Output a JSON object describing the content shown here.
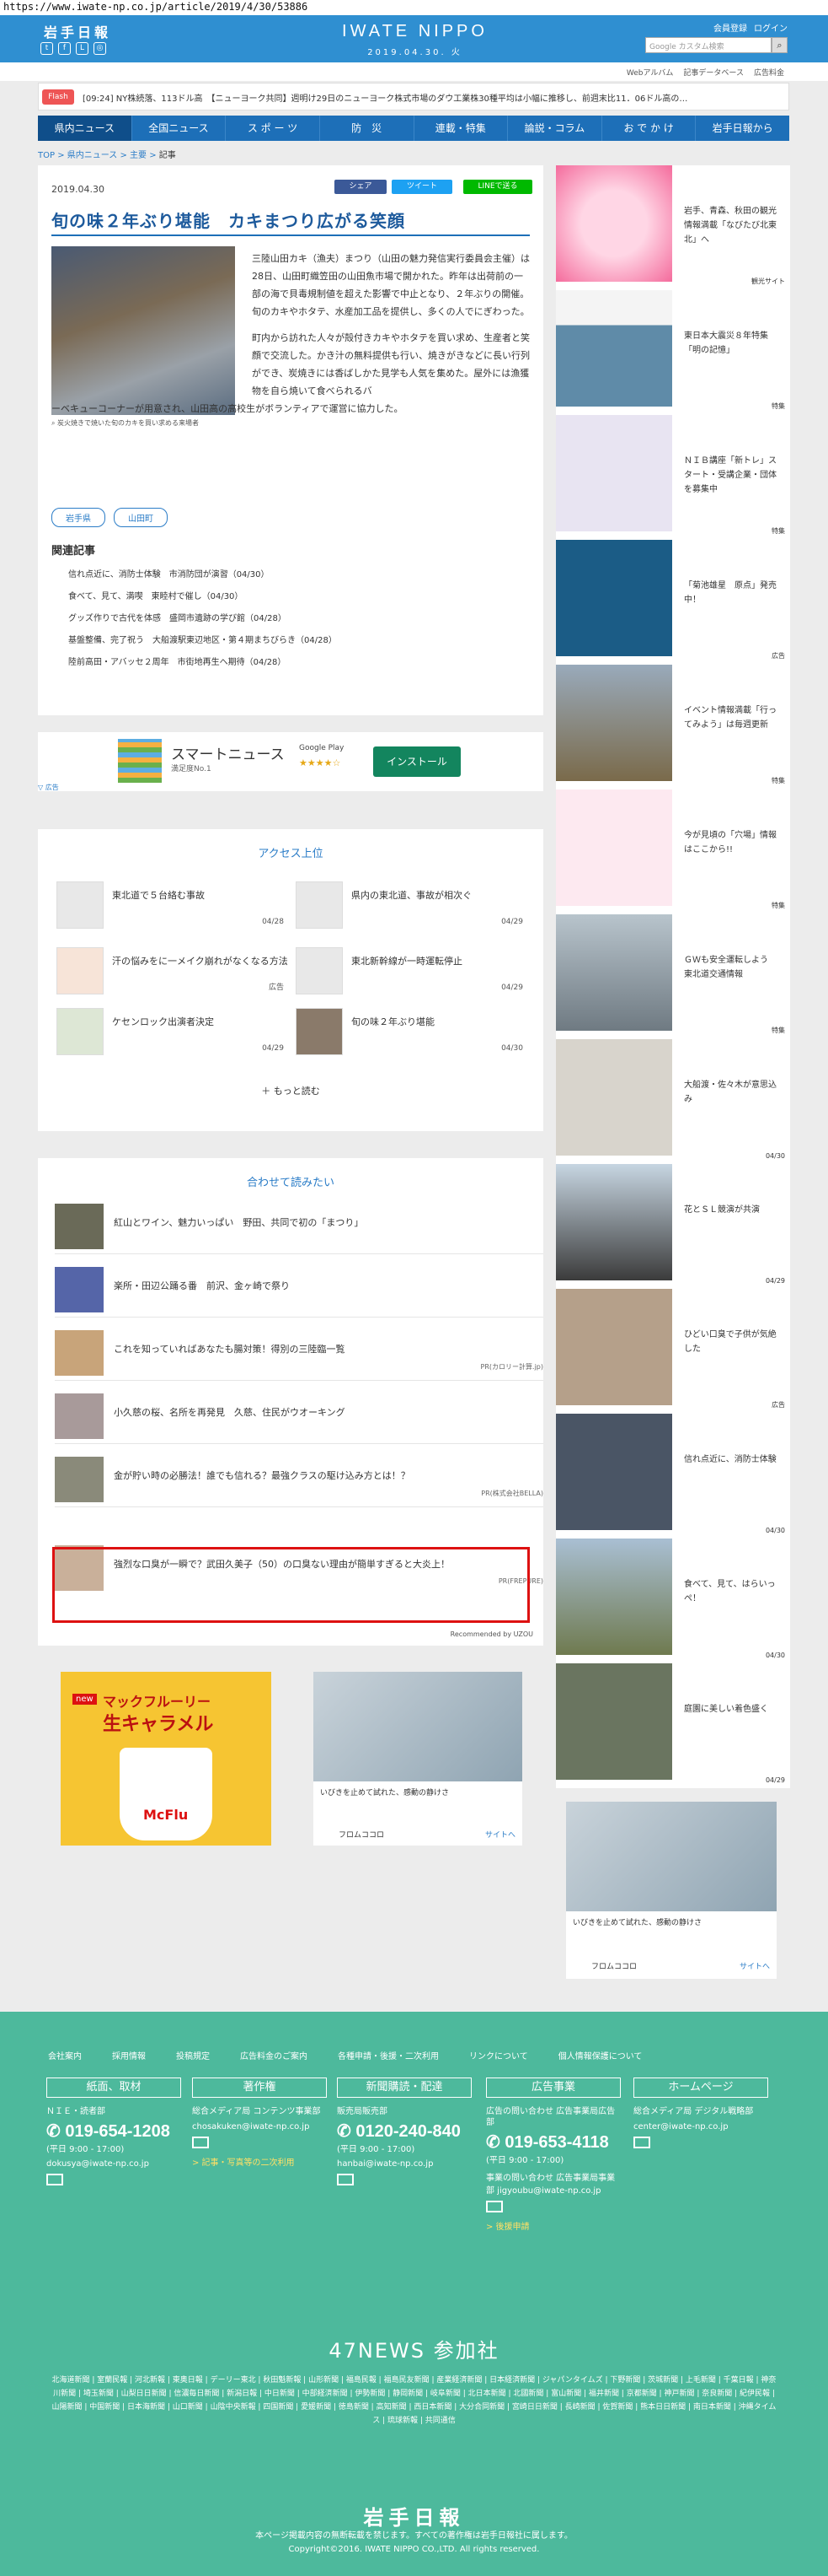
{
  "url": "https://www.iwate-np.co.jp/article/2019/4/30/53886",
  "header": {
    "logo": "岩手日報",
    "brand": "IWATE NIPPO",
    "date": "2019.04.30. 火",
    "links": [
      "会員登録",
      "ログイン"
    ],
    "search_placeholder": "Google カスタム検索",
    "search_icon": "search-icon"
  },
  "util_links": [
    "Webアルバム",
    "記事データベース",
    "広告料金"
  ],
  "ticker": {
    "tag": "Flash",
    "text": "[09:24] NY株続落、113ドル高　【ニューヨーク共同】週明け29日のニューヨーク株式市場のダウ工業株30種平均は小幅に推移し、前週末比11．06ドル高の…"
  },
  "nav": [
    "県内ニュース",
    "全国ニュース",
    "ス ポ ー ツ",
    "防　災",
    "連載・特集",
    "論説・コラム",
    "お で か け",
    "岩手日報から"
  ],
  "breadcrumb": [
    "TOP",
    "県内ニュース",
    "主要",
    "記事"
  ],
  "article": {
    "date": "2019.04.30",
    "share": [
      "シェア",
      "ツイート",
      "LINEで送る"
    ],
    "title": "旬の味２年ぶり堪能　カキまつり広がる笑顔",
    "caption": "炭火焼きで焼いた旬のカキを買い求める来場者",
    "p1": "三陸山田カキ（漁夫）まつり（山田の魅力発信実行委員会主催）は28日、山田町織笠田の山田魚市場で開かれた。昨年は出荷前の一部の海で貝毒規制値を超えた影響で中止となり、２年ぶりの開催。旬のカキやホタテ、水産加工品を提供し、多くの人でにぎわった。",
    "p2": "町内から訪れた人々が殻付きカキやホタテを買い求め、生産者と笑顔で交流した。かき汁の無料提供も行い、焼きがきなどに長い行列ができ、炭焼きには香ばしかた見学も人気を集めた。屋外には漁獲物を自ら焼いて食べられるバ",
    "p3": "ーベキューコーナーが用意され、山田高の高校生がボランティアで運営に協力した。",
    "tags": [
      "岩手県",
      "山田町"
    ],
    "related_heading": "関連記事",
    "related": [
      "信れ点近に、消防士体験　市消防団が演習（04/30）",
      "食べて、見て、満喫　東睦村で催し（04/30）",
      "グッズ作りで古代を体感　盛岡市遺跡の学び館（04/28）",
      "基盤整備、完了祝う　大船渡駅東辺地区・第４期まちびらき（04/28）",
      "陸前高田・アバッセ２周年　市街地再生へ期待（04/28）"
    ]
  },
  "app_ad": {
    "name": "スマートニュース",
    "sub": "満足度No.1",
    "store": "Google Play",
    "stars": "★★★★☆",
    "install": "インストール",
    "label": "広告"
  },
  "access": {
    "heading": "アクセス上位",
    "items": [
      {
        "text": "東北道で５台絡む事故",
        "date": "04/28"
      },
      {
        "text": "県内の東北道、事故が相次ぐ",
        "date": "04/29"
      },
      {
        "text": "汗の悩みをに一メイク崩れがなくなる方法",
        "date": "広告"
      },
      {
        "text": "東北新幹線が一時運転停止",
        "date": "04/29"
      },
      {
        "text": "ケセンロック出演者決定",
        "date": "04/29"
      },
      {
        "text": "旬の味２年ぶり堪能",
        "date": "04/30"
      }
    ],
    "more": "もっと読む"
  },
  "recommend": {
    "heading": "合わせて読みたい",
    "items": [
      {
        "text": "紅山とワイン、魅力いっぱい　野田、共同で初の「まつり」",
        "pr": ""
      },
      {
        "text": "楽所・田辺公踊る番　前沢、金ヶ崎で祭り",
        "pr": ""
      },
      {
        "text": "これを知っていればあなたも腸対策！得別の三陸臨一覧",
        "pr": "PR(カロリー計算.jp)"
      },
      {
        "text": "小久慈の桜、名所を再発見　久慈、住民がウオーキング",
        "pr": ""
      },
      {
        "text": "金が貯い時の必勝法！誰でも信れる？最強クラスの駆け込み方とは！？",
        "pr": "PR(株式会社BELLA)"
      },
      {
        "text": "強烈な口臭が一瞬で？武田久美子（50）の口臭ない理由が簡単すぎると大炎上！",
        "pr": "PR(FREPURE)"
      }
    ],
    "credit": "Recommended by UZOU"
  },
  "ads": {
    "mc_top": "new",
    "mc_name": "マックフルーリー",
    "mc_sub": "生キャラメル",
    "mc_brand": "McFlu",
    "ad2_text": "いびきを止めて試れた、感動の静けさ",
    "ad2_brand": "フロムココロ",
    "ad2_site": "サイトへ"
  },
  "sidebar": [
    {
      "text": "岩手、青森、秋田の観光情報満載「なびたび北東北」へ",
      "foot": "観光サイト"
    },
    {
      "text": "東日本大震災８年特集「明の記憶」",
      "foot": "特集"
    },
    {
      "text": "ＮＩＢ講座「新トレ」スタート・受講企業・団体を募集中",
      "foot": "特集"
    },
    {
      "text": "「菊池雄星　原点」発売中！",
      "foot": "広告"
    },
    {
      "text": "イベント情報満載「行ってみよう」は毎週更新",
      "foot": "特集"
    },
    {
      "text": "今が見頃の「穴場」情報はここから!!",
      "foot": "特集"
    },
    {
      "text": "ＧＷも安全運転しよう　東北道交通情報",
      "foot": "特集"
    },
    {
      "text": "大船渡・佐々木が意思込み",
      "foot": "04/30"
    },
    {
      "text": "花とＳＬ競演が共演",
      "foot": "04/29"
    },
    {
      "text": "ひどい口臭で子供が気絶した",
      "foot": "広告"
    },
    {
      "text": "信れ点近に、消防士体験",
      "foot": "04/30"
    },
    {
      "text": "食べて、見て、はらいっぺ！",
      "foot": "04/30"
    },
    {
      "text": "庭園に美しい着色盛く",
      "foot": "04/29"
    }
  ],
  "side_ad": {
    "text": "いびきを止めて試れた、感動の静けさ",
    "brand": "フロムココロ",
    "site": "サイトへ"
  },
  "footer": {
    "links": [
      "会社案内",
      "採用情報",
      "投稿規定",
      "広告料金のご案内",
      "各種申請・後援・二次利用",
      "リンクについて",
      "個人情報保護について"
    ],
    "cols": [
      {
        "h": "紙面、取材",
        "l": "ＮＩＥ・読者部",
        "ph": "019-654-1208",
        "tm": "(平日 9:00 - 17:00)",
        "em": "dokusya@iwate-np.co.jp",
        "lk": ""
      },
      {
        "h": "著作権",
        "l": "総合メディア局 コンテンツ事業部",
        "ph": "",
        "tm": "",
        "em": "chosakuken@iwate-np.co.jp",
        "lk": "> 記事・写真等の二次利用"
      },
      {
        "h": "新聞購読・配達",
        "l": "販売局販売部",
        "ph": "0120-240-840",
        "tm": "(平日 9:00 - 17:00)",
        "em": "hanbai@iwate-np.co.jp",
        "lk": ""
      },
      {
        "h": "広告事業",
        "l": "広告の問い合わせ 広告事業局広告部",
        "ph": "019-653-4118",
        "tm": "(平日 9:00 - 17:00)",
        "em": "事業の問い合わせ 広告事業局事業部 jigyoubu@iwate-np.co.jp",
        "lk": "> 後援申請"
      },
      {
        "h": "ホームページ",
        "l": "総合メディア局 デジタル戦略部",
        "ph": "",
        "tm": "",
        "em": "center@iwate-np.co.jp",
        "lk": ""
      }
    ],
    "news47": "47NEWS 参加社",
    "papers": "北海道新聞 | 室蘭民報 | 河北新報 | 東奥日報 | デーリー東北 | 秋田魁新報 | 山形新聞 | 福島民報 | 福島民友新聞 | 産業経済新聞 | 日本経済新聞 | ジャパンタイムズ | 下野新聞 | 茨城新聞 | 上毛新聞 | 千葉日報 | 神奈川新聞 | 埼玉新聞 | 山梨日日新聞 | 信濃毎日新聞 | 新潟日報 | 中日新聞 | 中部経済新聞 | 伊勢新聞 | 静岡新聞 | 岐阜新聞 | 北日本新聞 | 北國新聞 | 富山新聞 | 福井新聞 | 京都新聞 | 神戸新聞 | 奈良新聞 | 紀伊民報 | 山陽新聞 | 中国新聞 | 日本海新聞 | 山口新聞 | 山陰中央新報 | 四国新聞 | 愛媛新聞 | 徳島新聞 | 高知新聞 | 西日本新聞 | 大分合同新聞 | 宮崎日日新聞 | 長崎新聞 | 佐賀新聞 | 熊本日日新聞 | 南日本新聞 | 沖縄タイムス | 琉球新報 | 共同通信",
    "logo": "岩手日報",
    "notice": "本ページ掲載内容の無断転載を禁じます。すべての著作権は岩手日報社に属します。",
    "copyright": "Copyright©2016. IWATE NIPPO CO.,LTD. All rights reserved."
  }
}
